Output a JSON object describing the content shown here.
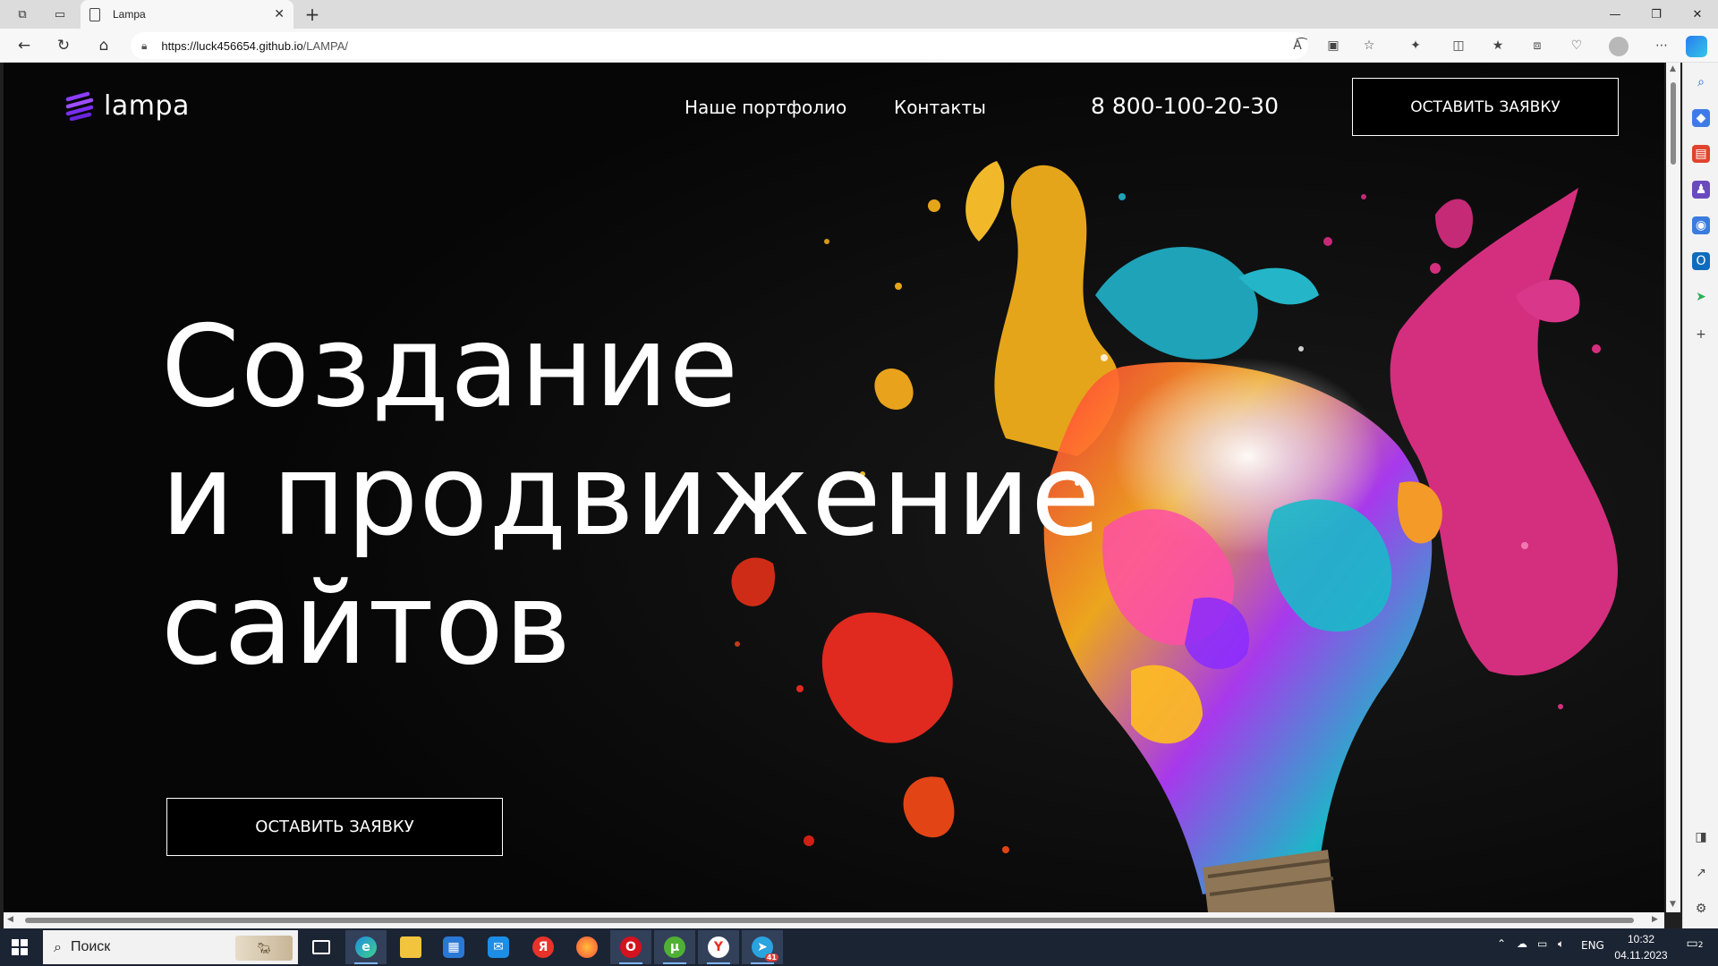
{
  "browser": {
    "tab_title": "Lampa",
    "url_host": "https://luck456654.github.io",
    "url_path": "/LAMPA/"
  },
  "site": {
    "logo_text": "lampa",
    "nav": {
      "portfolio": "Наше портфолио",
      "contacts": "Контакты"
    },
    "phone": "8 800-100-20-30",
    "cta_top": "ОСТАВИТЬ ЗАЯВКУ",
    "hero": {
      "line1": "Создание",
      "line2": "и продвижение",
      "line3": "сайтов"
    },
    "cta_hero": "ОСТАВИТЬ ЗАЯВКУ"
  },
  "taskbar": {
    "search_placeholder": "Поиск",
    "language": "ENG",
    "time": "10:32",
    "date": "04.11.2023",
    "telegram_badge": "41",
    "notifications": "2"
  },
  "colors": {
    "page_bg": "#060606",
    "logo_accent": "#8b3dff",
    "text": "#ffffff",
    "taskbar_bg": "#1b2433"
  }
}
